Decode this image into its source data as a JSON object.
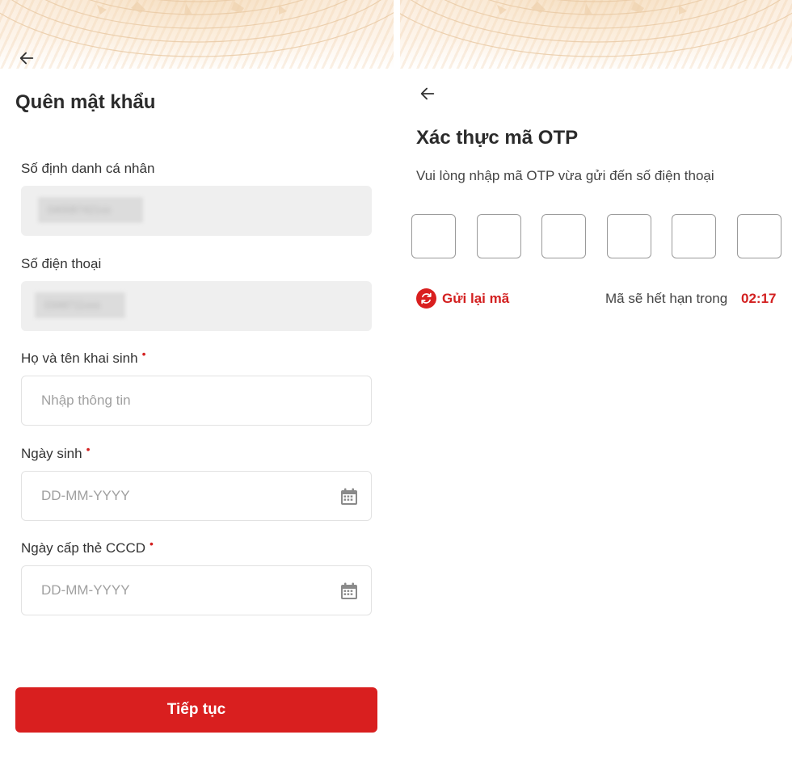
{
  "colors": {
    "accent": "#d91f1f",
    "disabled_field": "#efefef",
    "banner": "#fbeee0"
  },
  "forgot_password": {
    "back_icon": "arrow-left-icon",
    "title": "Quên mật khẩu",
    "id_number": {
      "label": "Số định danh cá nhân",
      "value_blurred": "040087421xx"
    },
    "phone": {
      "label": "Số điện thoại",
      "value_blurred": "0348711xxx"
    },
    "full_name": {
      "label": "Họ và tên khai sinh",
      "required_mark": "•",
      "placeholder": "Nhập thông tin"
    },
    "birth_date": {
      "label": "Ngày sinh",
      "required_mark": "•",
      "placeholder": "DD-MM-YYYY",
      "icon": "calendar-icon"
    },
    "id_issue_date": {
      "label": "Ngày cấp thẻ CCCD",
      "required_mark": "•",
      "placeholder": "DD-MM-YYYY",
      "icon": "calendar-icon"
    },
    "continue_label": "Tiếp tục"
  },
  "otp": {
    "back_icon": "arrow-left-icon",
    "title": "Xác thực mã OTP",
    "subtitle": "Vui lòng nhập mã OTP vừa gửi đến số điện thoại",
    "digit_count": 6,
    "resend_label": "Gửi lại mã",
    "resend_icon": "refresh-icon",
    "expire_text": "Mã sẽ hết hạn trong",
    "timer": "02:17"
  }
}
